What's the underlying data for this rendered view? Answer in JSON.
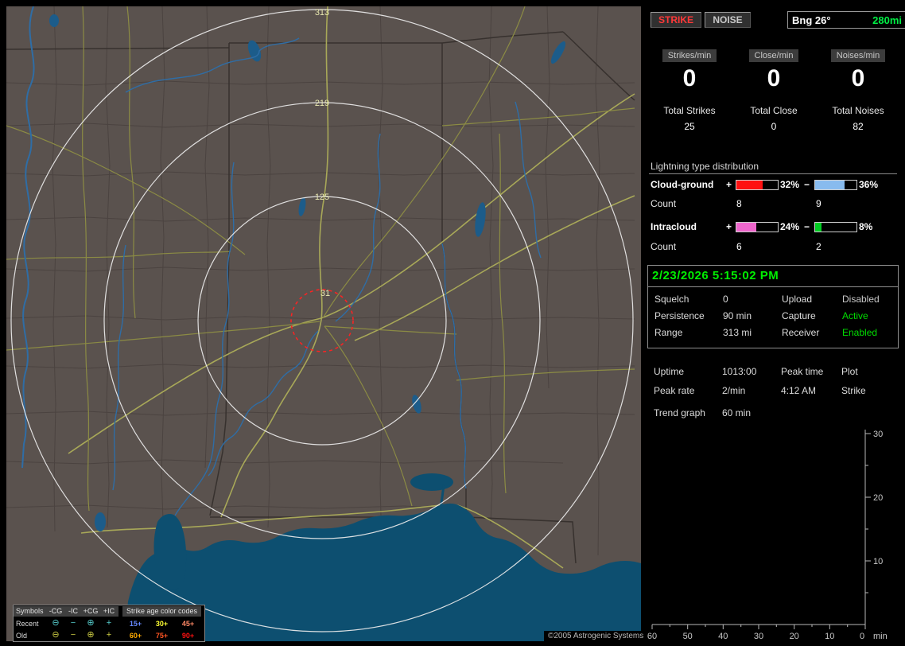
{
  "toolbar": {
    "strike": "STRIKE",
    "noise": "NOISE",
    "bearing": "Bng 26°",
    "range": "280mi"
  },
  "rates": {
    "columns": [
      {
        "header": "Strikes/min",
        "rate": "0",
        "total_label": "Total Strikes",
        "total": "25"
      },
      {
        "header": "Close/min",
        "rate": "0",
        "total_label": "Total Close",
        "total": "0"
      },
      {
        "header": "Noises/min",
        "rate": "0",
        "total_label": "Total Noises",
        "total": "82"
      }
    ]
  },
  "distribution": {
    "title": "Lightning type distribution",
    "count_label": "Count",
    "rows": [
      {
        "label": "Cloud-ground",
        "plus_sign": "+",
        "minus_sign": "−",
        "plus_pct": "32%",
        "plus_count": "8",
        "plus_fill": 64,
        "plus_color": "#ff1111",
        "minus_pct": "36%",
        "minus_count": "9",
        "minus_fill": 72,
        "minus_color": "#88bbee"
      },
      {
        "label": "Intracloud",
        "plus_sign": "+",
        "minus_sign": "−",
        "plus_pct": "24%",
        "plus_count": "6",
        "plus_fill": 48,
        "plus_color": "#ee66cc",
        "minus_pct": "8%",
        "minus_count": "2",
        "minus_fill": 16,
        "minus_color": "#00cc22"
      }
    ]
  },
  "status_panel": {
    "datetime": "2/23/2026 5:15:02 PM",
    "rows": [
      {
        "label1": "Squelch",
        "value1": "0",
        "label2": "Upload",
        "value2": "Disabled",
        "value2_color": "#c8c8c8"
      },
      {
        "label1": "Persistence",
        "value1": "90 min",
        "label2": "Capture",
        "value2": "Active",
        "value2_color": "#00dd00"
      },
      {
        "label1": "Range",
        "value1": "313 mi",
        "label2": "Receiver",
        "value2": "Enabled",
        "value2_color": "#00dd00"
      }
    ]
  },
  "stats_panel": {
    "rows": [
      {
        "c1": "Uptime",
        "c2": "1013:00",
        "c3": "Peak time",
        "c4": "Plot"
      },
      {
        "c1": "Peak rate",
        "c2": "2/min",
        "c3": "4:12 AM",
        "c4": "Strike"
      }
    ],
    "trend_label": "Trend graph",
    "trend_value": "60 min"
  },
  "trend_graph": {
    "y_ticks": [
      "30",
      "20",
      "10"
    ],
    "x_ticks": [
      "60",
      "50",
      "40",
      "30",
      "20",
      "10",
      "0"
    ],
    "x_unit": "min",
    "y_max": 30,
    "x_range_min": 60
  },
  "map": {
    "ring_labels": {
      "r313": "313",
      "r219": "219",
      "r125": "125",
      "r31": "31"
    },
    "copyright": "©2005 Astrogenic Systems",
    "legend": {
      "symbols_title": "Symbols",
      "age_title": "Strike age color codes",
      "columns": [
        "-CG",
        "-IC",
        "+CG",
        "+IC"
      ],
      "glyphs": [
        "⊖",
        "−",
        "⊕",
        "+"
      ],
      "rows": [
        {
          "label": "Recent",
          "symbol_color": "#55cccc",
          "ages": [
            {
              "text": "15+",
              "color": "#6688ff"
            },
            {
              "text": "30+",
              "color": "#ffff33"
            },
            {
              "text": "45+",
              "color": "#ff8866"
            }
          ]
        },
        {
          "label": "Old",
          "symbol_color": "#cccc44",
          "ages": [
            {
              "text": "60+",
              "color": "#ffaa00"
            },
            {
              "text": "75+",
              "color": "#ff5522"
            },
            {
              "text": "90+",
              "color": "#ff1111"
            }
          ]
        }
      ]
    }
  }
}
